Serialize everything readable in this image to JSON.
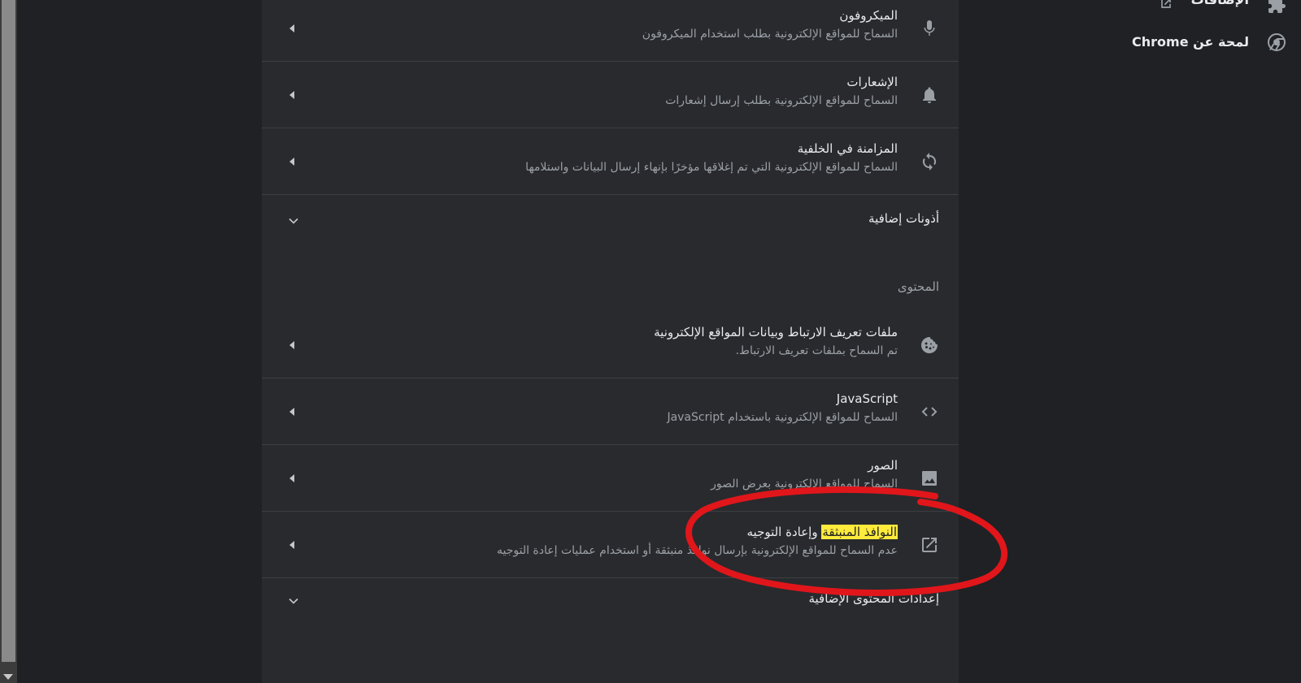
{
  "sidebar": {
    "extensions_label": "الإضافات",
    "about_label": "لمحة عن Chrome"
  },
  "permissions": [
    {
      "title": "الميكروفون",
      "subtitle": "السماح للمواقع الإلكترونية بطلب استخدام الميكروفون",
      "icon": "microphone-icon"
    },
    {
      "title": "الإشعارات",
      "subtitle": "السماح للمواقع الإلكترونية بطلب إرسال إشعارات",
      "icon": "bell-icon"
    },
    {
      "title": "المزامنة في الخلفية",
      "subtitle": "السماح للمواقع الإلكترونية التي تم إغلاقها مؤخرًا بإنهاء إرسال البيانات واستلامها",
      "icon": "sync-icon"
    }
  ],
  "additional_permissions_label": "أذونات إضافية",
  "content_section_label": "المحتوى",
  "content": [
    {
      "title": "ملفات تعريف الارتباط وبيانات المواقع الإلكترونية",
      "subtitle": "تم السماح بملفات تعريف الارتباط.",
      "icon": "cookie-icon"
    },
    {
      "title": "JavaScript",
      "subtitle": "السماح للمواقع الإلكترونية باستخدام JavaScript",
      "icon": "code-icon"
    },
    {
      "title": "الصور",
      "subtitle": "السماح للمواقع الإلكترونية بعرض الصور",
      "icon": "image-icon"
    },
    {
      "title_highlight": "النوافذ المنبثقة",
      "title_rest": " وإعادة التوجيه",
      "subtitle": "عدم السماح للمواقع الإلكترونية بإرسال نوافذ منبثقة أو استخدام عمليات إعادة التوجيه",
      "icon": "open-in-new-icon"
    }
  ],
  "additional_content_label": "إعدادات المحتوى الإضافية",
  "colors": {
    "highlight": "#ffeb3b",
    "annotation": "#e0161b",
    "panel": "#292a2d",
    "background": "#202124"
  }
}
